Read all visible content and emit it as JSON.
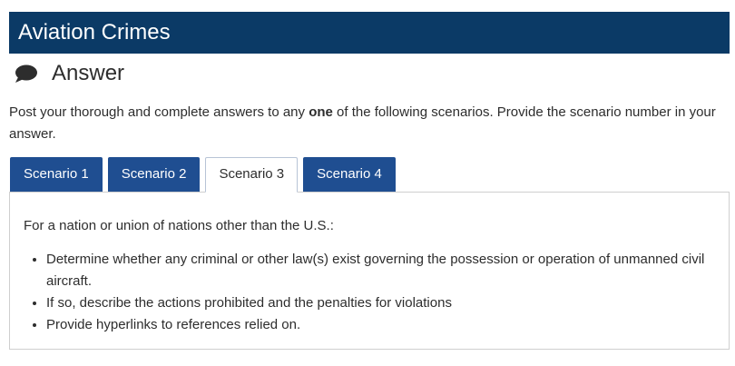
{
  "header": {
    "title": "Aviation Crimes"
  },
  "answer": {
    "icon": "speech-bubble-icon",
    "label": "Answer"
  },
  "instructions": {
    "part1": "Post your thorough and complete answers to any ",
    "emphasis": "one",
    "part2": " of the following scenarios. Provide the scenario number in your answer."
  },
  "tabs": [
    {
      "label": "Scenario 1",
      "active": false
    },
    {
      "label": "Scenario 2",
      "active": false
    },
    {
      "label": "Scenario 3",
      "active": true
    },
    {
      "label": "Scenario 4",
      "active": false
    }
  ],
  "panel": {
    "lead": "For a nation or union of nations other than the U.S.:",
    "bullets": [
      "Determine whether any criminal or other law(s) exist governing the possession or operation of unmanned civil aircraft.",
      "If so, describe the actions prohibited and the penalties for violations",
      "Provide hyperlinks to references relied on."
    ]
  },
  "colors": {
    "title_bar": "#0b3a66",
    "tab_inactive": "#1f4e91",
    "text": "#2d2d2d"
  }
}
